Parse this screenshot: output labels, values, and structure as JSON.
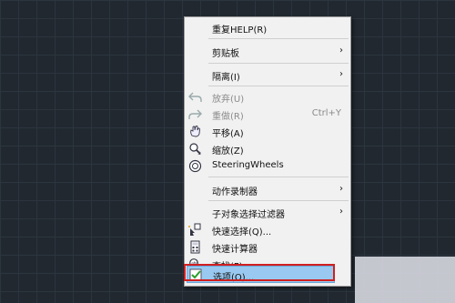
{
  "menu": {
    "items": [
      {
        "label": "重复HELP(R)"
      },
      {
        "label": "剪贴板"
      },
      {
        "label": "隔离(I)"
      },
      {
        "label": "放弃(U)"
      },
      {
        "label": "重做(R)",
        "shortcut": "Ctrl+Y"
      },
      {
        "label": "平移(A)"
      },
      {
        "label": "缩放(Z)"
      },
      {
        "label": "SteeringWheels"
      },
      {
        "label": "动作录制器"
      },
      {
        "label": "子对象选择过滤器"
      },
      {
        "label": "快速选择(Q)..."
      },
      {
        "label": "快速计算器"
      },
      {
        "label": "查找(F)..."
      },
      {
        "label": "选项(O)..."
      }
    ],
    "submenu_arrow": "›"
  },
  "icons": [
    "undo-icon",
    "redo-icon",
    "pan-icon",
    "zoom-icon",
    "steeringwheels-icon",
    "quick-select-icon",
    "calculator-icon",
    "find-icon",
    "options-check-icon"
  ],
  "colors": {
    "selection": "#99c9f0",
    "highlight_box": "#d11f1f",
    "canvas": "#212830"
  }
}
